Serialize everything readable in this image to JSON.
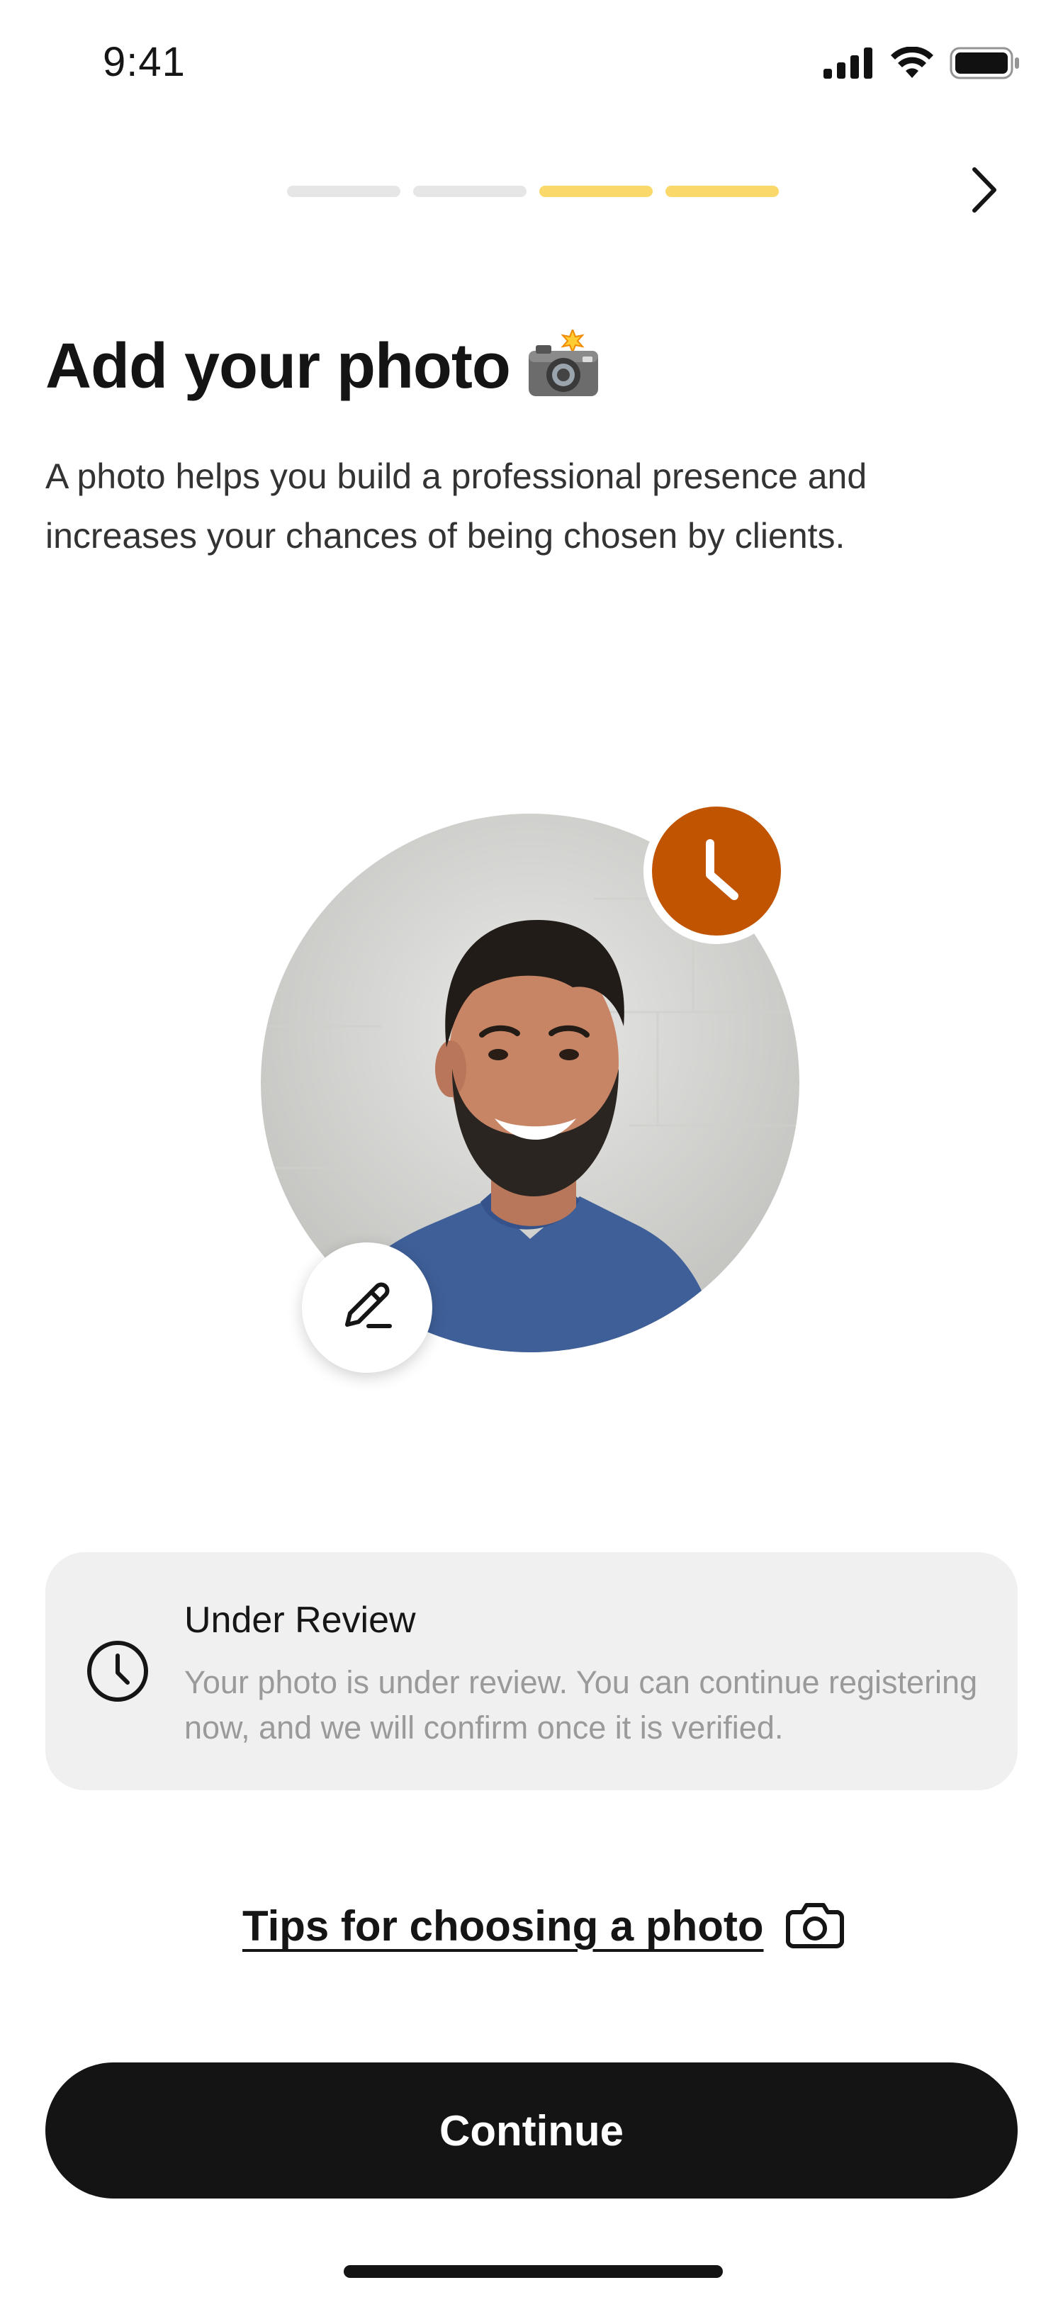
{
  "status_bar": {
    "time": "9:41",
    "icons": [
      "signal-icon",
      "wifi-icon",
      "battery-icon"
    ]
  },
  "progress": {
    "total_steps": 4,
    "completed_steps": 2,
    "active_color": "#fad96a",
    "inactive_color": "#e6e6e6"
  },
  "header": {
    "next_icon": "chevron-right-icon"
  },
  "page": {
    "title": "Add your photo",
    "title_emoji": "📸",
    "subtitle": "A photo helps you build a professional presence and increases your chances of being chosen by clients."
  },
  "photo": {
    "status_icon": "clock-icon",
    "status_color": "#c15400",
    "edit_icon": "pencil-icon"
  },
  "review_card": {
    "icon": "clock-icon",
    "title": "Under Review",
    "text": "Your photo is under review. You can continue registering now, and we will confirm once it is verified."
  },
  "tips": {
    "label": "Tips for choosing a photo",
    "icon": "camera-icon"
  },
  "actions": {
    "continue_label": "Continue"
  }
}
